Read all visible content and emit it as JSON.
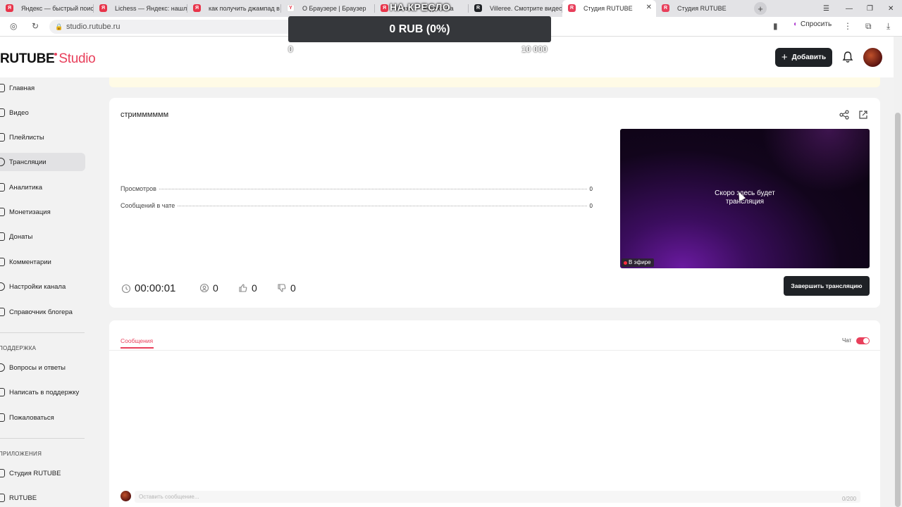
{
  "browser": {
    "tabs": [
      {
        "label": "Яндекс — быстрый поиск",
        "fav": "Я",
        "color": "#e8344a"
      },
      {
        "label": "Lichess — Яндекс: нашло",
        "fav": "Я",
        "color": "#e8344a"
      },
      {
        "label": "как получить джампад в",
        "fav": "Я",
        "color": "#e8344a"
      },
      {
        "label": "О Браузере | Браузер",
        "fav": "Y",
        "color": "#ffffff"
      },
      {
        "label": "Шиза — Яндекс: на",
        "fav": "Я",
        "color": "#e8344a"
      },
      {
        "label": "Villeree. Смотрите видео",
        "fav": "R",
        "color": "#1f2226"
      },
      {
        "label": "Студия RUTUBE",
        "fav": "R",
        "color": "#e83f5b"
      },
      {
        "label": "Студия RUTUBE",
        "fav": "R",
        "color": "#e83f5b"
      }
    ],
    "url": "studio.rutube.ru",
    "ask_label": "Спросить"
  },
  "overlay": {
    "title": "НА КРЕСЛО",
    "amount": "0 RUB (0%)",
    "min": "0",
    "max": "10 000"
  },
  "header": {
    "logo_brand": "RUTUBE",
    "logo_studio": "Studio",
    "add_label": "Добавить"
  },
  "sidebar": {
    "items": [
      {
        "label": "Главная"
      },
      {
        "label": "Видео"
      },
      {
        "label": "Плейлисты"
      },
      {
        "label": "Трансляции"
      },
      {
        "label": "Аналитика"
      },
      {
        "label": "Монетизация"
      },
      {
        "label": "Донаты"
      },
      {
        "label": "Комментарии"
      },
      {
        "label": "Настройки канала"
      },
      {
        "label": "Справочник блогера"
      }
    ],
    "support_title": "ПОДДЕРЖКА",
    "support_items": [
      {
        "label": "Вопросы и ответы"
      },
      {
        "label": "Написать в поддержку"
      },
      {
        "label": "Пожаловаться"
      }
    ],
    "apps_title": "ПРИЛОЖЕНИЯ",
    "apps_items": [
      {
        "label": "Студия RUTUBE"
      },
      {
        "label": "RUTUBE"
      }
    ]
  },
  "stream": {
    "title": "стримммммм",
    "views_label": "Просмотров",
    "views_value": "0",
    "chat_label": "Сообщений в чате",
    "chat_value": "0",
    "preview_text_1": "Скоро здесь будет",
    "preview_text_2": "трансляция",
    "live_label": "В эфире",
    "timer": "00:00:01",
    "viewers": "0",
    "likes": "0",
    "dislikes": "0",
    "end_label": "Завершить трансляцию"
  },
  "chat": {
    "tab_label": "Сообщения",
    "toggle_label": "Чат",
    "toggle_on": true,
    "placeholder": "Оставить сообщение...",
    "counter": "0/200"
  },
  "colors": {
    "accent": "#e83f5b",
    "dark_button": "#1f2226"
  }
}
